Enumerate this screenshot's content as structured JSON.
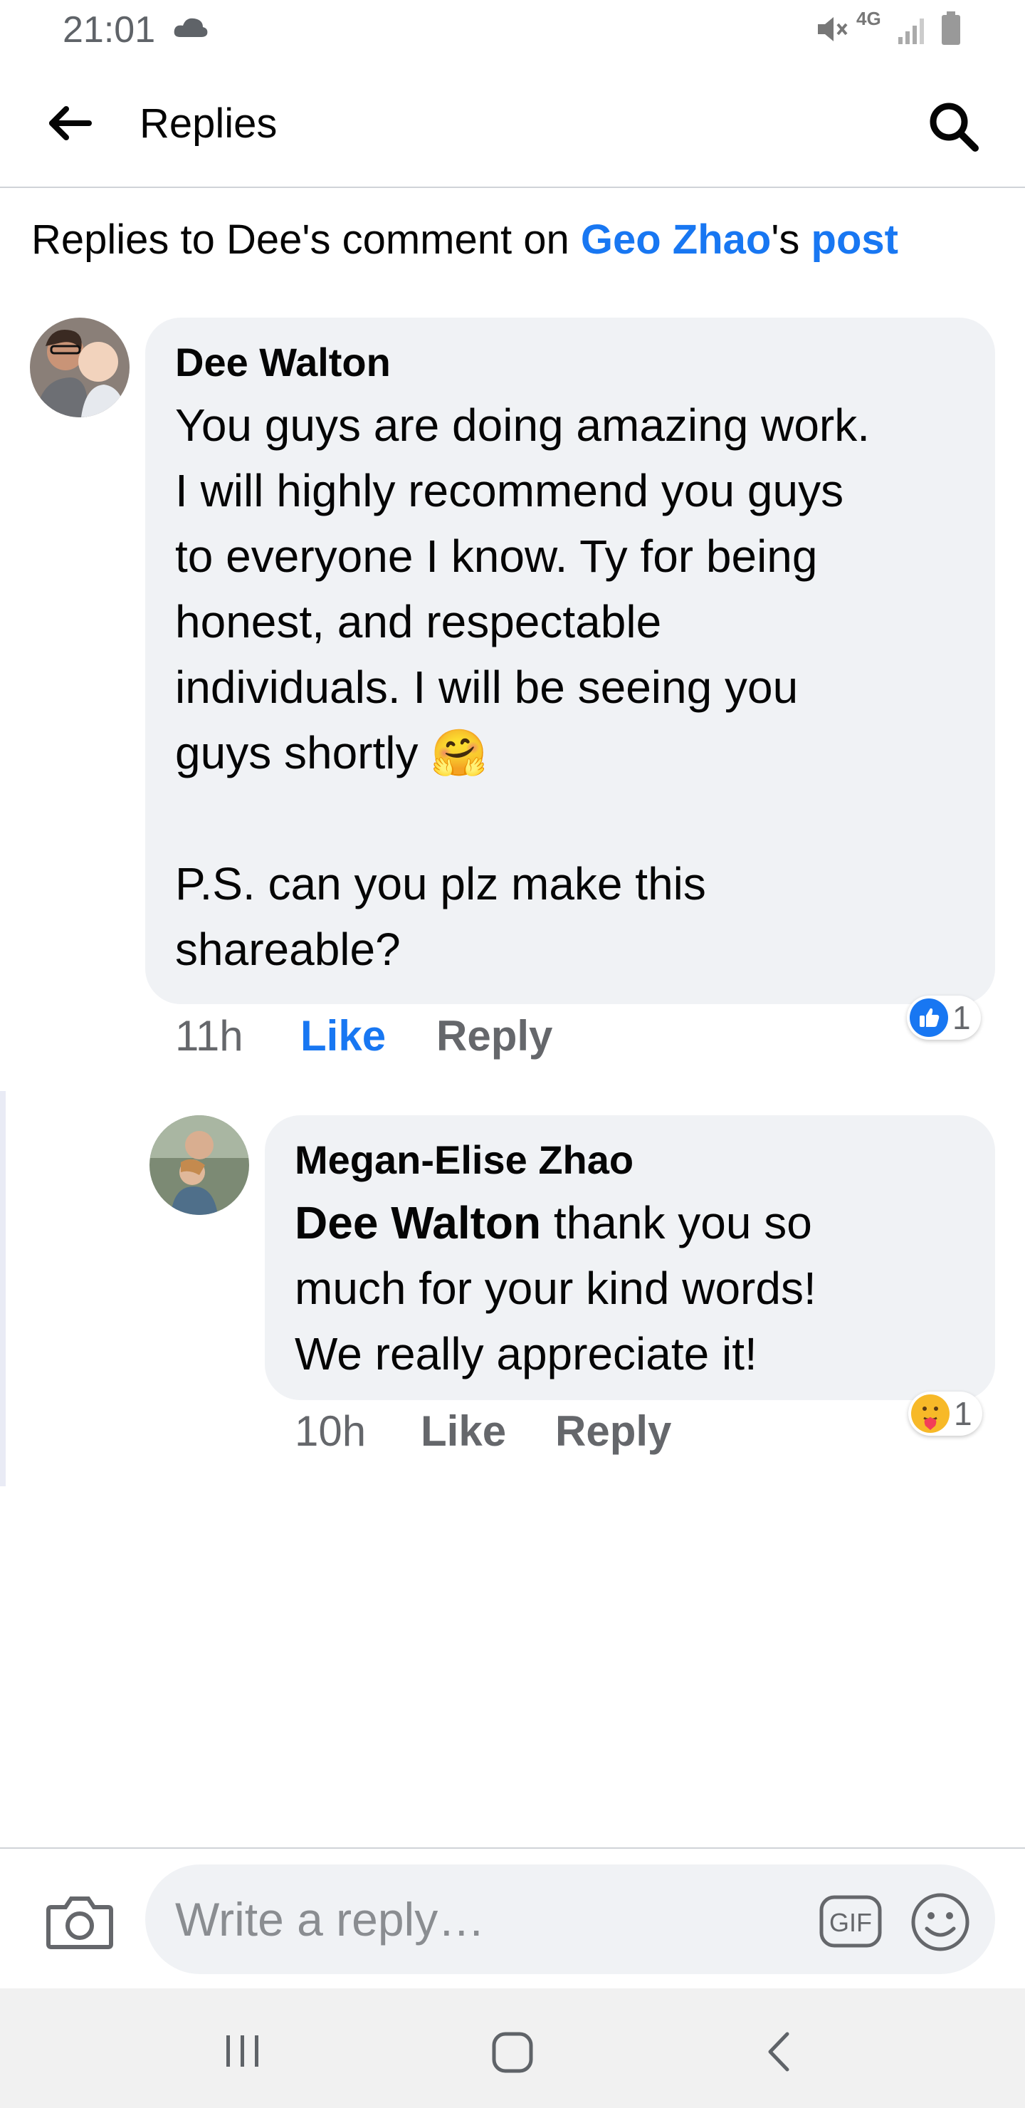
{
  "status_bar": {
    "time": "21:01",
    "network_label": "4G",
    "icons": [
      "cloud-icon",
      "mute-icon",
      "signal-icon",
      "battery-icon"
    ]
  },
  "header": {
    "title": "Replies",
    "back_icon": "arrow-left-icon",
    "search_icon": "search-icon"
  },
  "context": {
    "prefix": "Replies to Dee's comment on ",
    "user_link": "Geo Zhao",
    "possessive": "'s ",
    "post_link": "post"
  },
  "comments": [
    {
      "author": "Dee Walton",
      "text_lines": [
        "You guys are doing amazing work.",
        "I will highly recommend you guys",
        "to everyone I know. Ty for being",
        "honest, and respectable",
        "individuals. I will be seeing you",
        "guys shortly 🤗",
        "",
        "P.S. can you plz make this",
        "shareable?"
      ],
      "time": "11h",
      "like_label": "Like",
      "reply_label": "Reply",
      "reaction": {
        "type": "like",
        "count": "1"
      },
      "like_active": true
    },
    {
      "author": "Megan-Elise Zhao",
      "mention": "Dee Walton",
      "text_lines": [
        " thank you so",
        "much for your kind words!",
        "We really appreciate it!"
      ],
      "time": "10h",
      "like_label": "Like",
      "reply_label": "Reply",
      "reaction": {
        "type": "care",
        "count": "1"
      },
      "like_active": false
    }
  ],
  "composer": {
    "placeholder": "Write a reply…",
    "gif_label": "GIF",
    "camera_icon": "camera-icon",
    "emoji_icon": "smiley-icon"
  },
  "nav_bar": {
    "icons": [
      "recents-icon",
      "home-icon",
      "back-icon"
    ]
  },
  "colors": {
    "accent": "#1877f2",
    "bubble": "#f0f2f5",
    "meta": "#65676b"
  }
}
